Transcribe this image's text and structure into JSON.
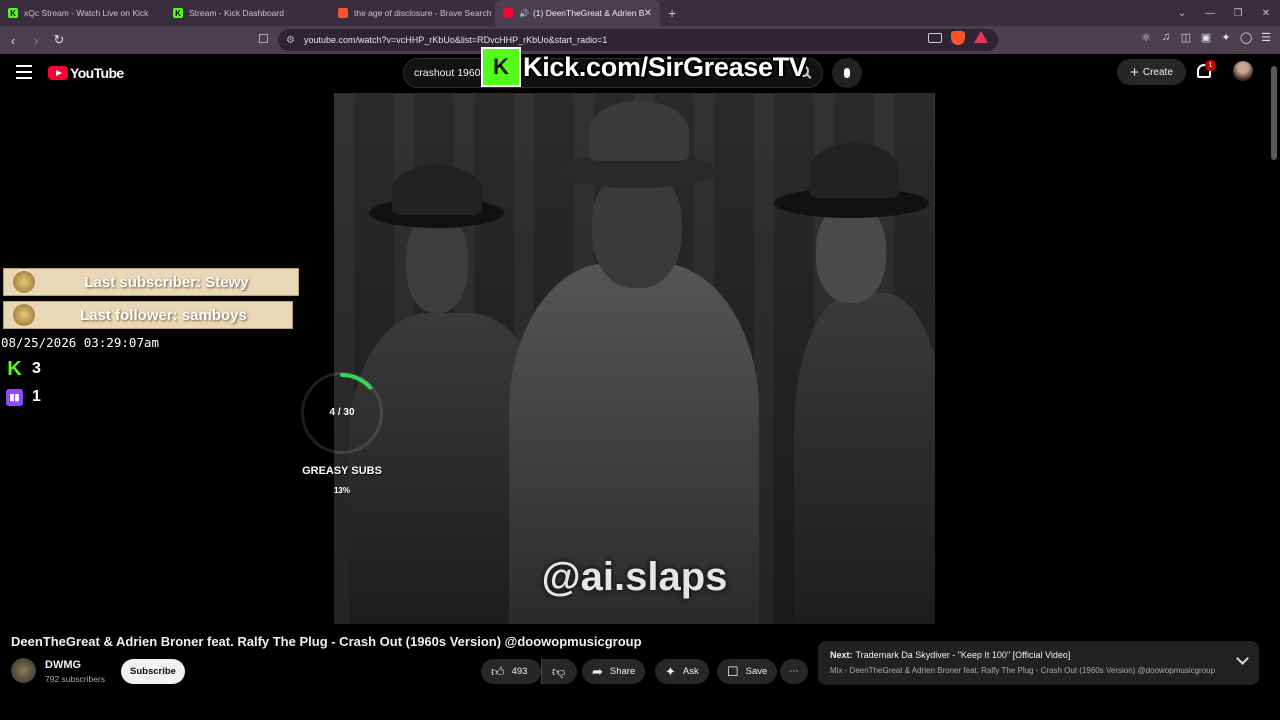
{
  "browser": {
    "tabs": [
      {
        "title": "xQc Stream - Watch Live on Kick",
        "icon": "kick-icon"
      },
      {
        "title": "Stream - Kick Dashboard",
        "icon": "kick-icon"
      },
      {
        "title": "the age of disclosure - Brave Search",
        "icon": "brave-icon"
      },
      {
        "title": "(1) DeenTheGreat & Adrien B",
        "icon": "youtube-icon",
        "active": true
      }
    ],
    "url": "youtube.com/watch?v=vcHHP_rKbUo&list=RDvcHHP_rKbUo&start_radio=1"
  },
  "youtube": {
    "logo_text": "YouTube",
    "search_value": "crashout 1960",
    "create_label": "Create",
    "notification_count": "1"
  },
  "overlay": {
    "kick_url": "Kick.com/SirGreaseTV",
    "last_subscriber": "Last subscriber: Stewy",
    "last_follower": "Last follower: samboys",
    "timestamp": "08/25/2026 03:29:07am",
    "kick_count": "3",
    "twitch_count": "1",
    "goal_progress": "4 / 30",
    "goal_fraction": 0.133,
    "goal_label": "GREASY SUBS",
    "goal_percent": "13%",
    "watermark": "@ai.slaps"
  },
  "video": {
    "title": "DeenTheGreat & Adrien Broner feat. Ralfy The Plug - Crash Out (1960s Version) @doowopmusicgroup",
    "channel": "DWMG",
    "subscribers": "792 subscribers",
    "subscribe_label": "Subscribe",
    "likes": "493",
    "share_label": "Share",
    "ask_label": "Ask",
    "save_label": "Save"
  },
  "next": {
    "prefix": "Next:",
    "title": "Trademark Da Skydiver - \"Keep It 100\" [Official Video]",
    "mix": "Mix - DeenTheGreat & Adrien Broner feat. Ralfy The Plug - Crash Out (1960s Version) @doowopmusicgroup"
  }
}
